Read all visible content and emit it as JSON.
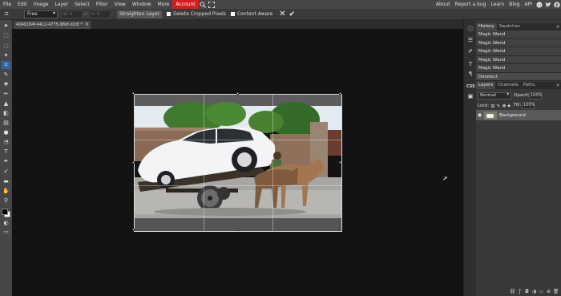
{
  "menubar": {
    "items": [
      "File",
      "Edit",
      "Image",
      "Layer",
      "Select",
      "Filter",
      "View",
      "Window",
      "More",
      "Account"
    ],
    "active": "Account",
    "search_icon": "search-icon",
    "fullscreen_icon": "fullscreen-icon",
    "right_links": [
      "About",
      "Report a bug",
      "Learn",
      "Blog",
      "API"
    ],
    "social_icons": [
      "reddit-icon",
      "twitter-icon",
      "facebook-icon"
    ]
  },
  "options": {
    "crop_icon": "crop-icon",
    "ratio_select": "Free",
    "width_label": "W: 0",
    "height_label": "H: 0",
    "straighten_label": "Straighten Layer",
    "delete_cropped_label": "Delete Cropped Pixels",
    "content_aware_label": "Content Aware",
    "cancel_icon": "close-icon",
    "commit_icon": "check-icon"
  },
  "document": {
    "tab_title": "4040184f-4412-4775-980f-d2df",
    "modified_mark": "*",
    "close": "×"
  },
  "tools": [
    {
      "name": "move-icon",
      "glyph": "➤"
    },
    {
      "name": "marquee-icon",
      "glyph": "⬚"
    },
    {
      "name": "lasso-icon",
      "glyph": "◌"
    },
    {
      "name": "magic-wand-icon",
      "glyph": "✦"
    },
    {
      "name": "crop-tool-icon",
      "glyph": "⌗"
    },
    {
      "name": "eyedropper-icon",
      "glyph": "✎"
    },
    {
      "name": "healing-icon",
      "glyph": "✚"
    },
    {
      "name": "brush-icon",
      "glyph": "✏"
    },
    {
      "name": "clone-stamp-icon",
      "glyph": "▲"
    },
    {
      "name": "eraser-icon",
      "glyph": "◧"
    },
    {
      "name": "gradient-icon",
      "glyph": "▤"
    },
    {
      "name": "blur-icon",
      "glyph": "●"
    },
    {
      "name": "dodge-icon",
      "glyph": "◔"
    },
    {
      "name": "text-tool-icon",
      "glyph": "T"
    },
    {
      "name": "pen-icon",
      "glyph": "✒"
    },
    {
      "name": "path-select-icon",
      "glyph": "➹"
    },
    {
      "name": "shape-icon",
      "glyph": "▬"
    },
    {
      "name": "hand-icon",
      "glyph": "✋"
    },
    {
      "name": "zoom-icon",
      "glyph": "⚲"
    }
  ],
  "right_icons": [
    {
      "name": "info-icon",
      "glyph": "ⓘ"
    },
    {
      "name": "history-panel-icon",
      "glyph": "☰"
    },
    {
      "name": "brush-settings-icon",
      "glyph": "✐"
    },
    {
      "name": "character-icon",
      "glyph": "T"
    },
    {
      "name": "paragraph-icon",
      "glyph": "¶"
    },
    {
      "name": "css-icon",
      "glyph": "CSS"
    },
    {
      "name": "image-panel-icon",
      "glyph": "▣"
    }
  ],
  "history_panel": {
    "tabs": [
      "History",
      "Swatches"
    ],
    "active_tab": "History",
    "items": [
      "Magic Wand",
      "Magic Wand",
      "Magic Wand",
      "Magic Wand",
      "Magic Wand",
      "Deselect"
    ]
  },
  "layers_panel": {
    "tabs": [
      "Layers",
      "Channels",
      "Paths"
    ],
    "active_tab": "Layers",
    "blend_mode": "Normal",
    "opacity_label": "Opacity:",
    "opacity_value": "100%",
    "lock_label": "Lock:",
    "fill_label": "Fill:",
    "fill_value": "100%",
    "layers": [
      {
        "name": "Background",
        "visible": true
      }
    ],
    "footer_icons": [
      "link-icon",
      "effects-icon",
      "mask-icon",
      "adjustment-icon",
      "folder-icon",
      "new-layer-icon",
      "trash-icon"
    ]
  },
  "colors": {
    "accent": "#d21e1e",
    "active_tool": "#2f6aa3",
    "foreground": "#000000",
    "background": "#ffffff"
  }
}
